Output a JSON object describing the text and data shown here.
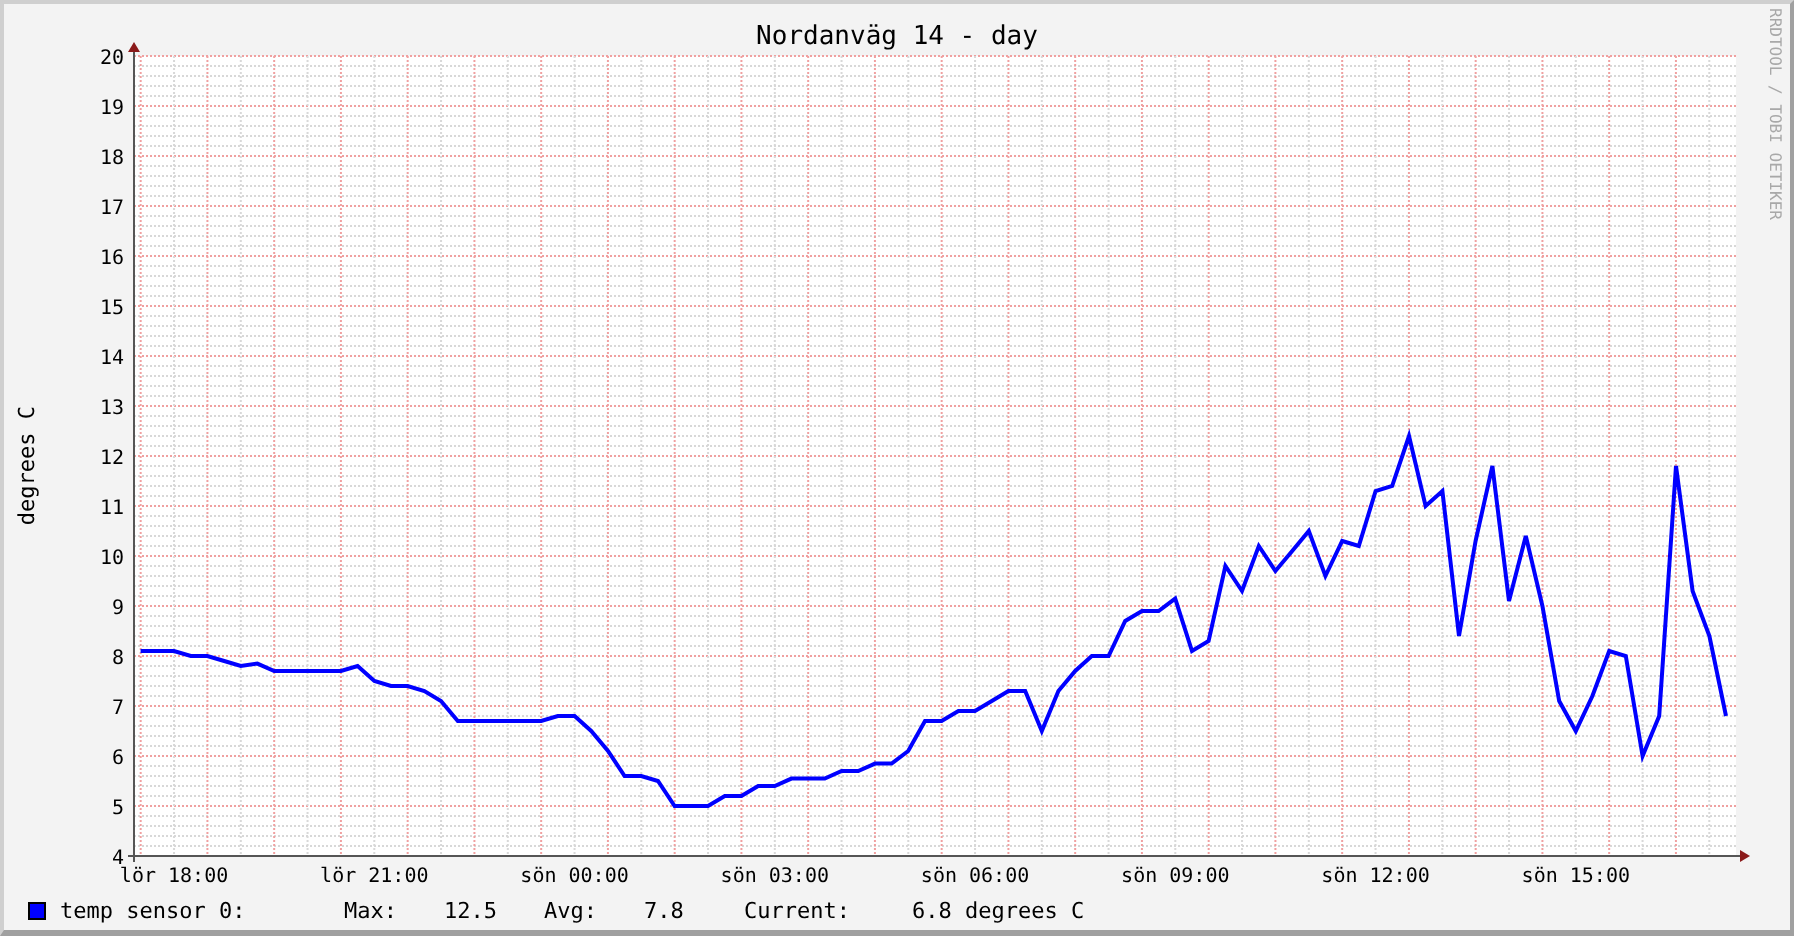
{
  "chart": {
    "chart_data": {
      "type": "line",
      "title": "Nordanväg 14 - day",
      "ylabel": "degrees C",
      "ylim": [
        4,
        20
      ],
      "grid": true,
      "yticks": [
        4,
        5,
        6,
        7,
        8,
        9,
        10,
        11,
        12,
        13,
        14,
        15,
        16,
        17,
        18,
        19,
        20
      ],
      "categories": [
        null,
        null,
        "lör 18:00",
        null,
        null,
        null,
        null,
        null,
        null,
        null,
        null,
        null,
        null,
        null,
        "lör 21:00",
        null,
        null,
        null,
        null,
        null,
        null,
        null,
        null,
        null,
        null,
        null,
        "sön 00:00",
        null,
        null,
        null,
        null,
        null,
        null,
        null,
        null,
        null,
        null,
        null,
        "sön 03:00",
        null,
        null,
        null,
        null,
        null,
        null,
        null,
        null,
        null,
        null,
        null,
        "sön 06:00",
        null,
        null,
        null,
        null,
        null,
        null,
        null,
        null,
        null,
        null,
        null,
        "sön 09:00",
        null,
        null,
        null,
        null,
        null,
        null,
        null,
        null,
        null,
        null,
        null,
        "sön 12:00",
        null,
        null,
        null,
        null,
        null,
        null,
        null,
        null,
        null,
        null,
        null,
        "sön 15:00",
        null,
        null,
        null,
        null,
        null,
        null,
        null,
        null,
        null
      ],
      "series": [
        {
          "name": "temp sensor 0:",
          "color": "#0000ff",
          "values": [
            8.1,
            8.1,
            8.1,
            8.0,
            8.0,
            7.9,
            7.8,
            7.85,
            7.7,
            7.7,
            7.7,
            7.7,
            7.7,
            7.8,
            7.5,
            7.4,
            7.4,
            7.3,
            7.1,
            6.7,
            6.7,
            6.7,
            6.7,
            6.7,
            6.7,
            6.8,
            6.8,
            6.5,
            6.1,
            5.6,
            5.6,
            5.5,
            5.0,
            5.0,
            5.0,
            5.2,
            5.2,
            5.4,
            5.4,
            5.55,
            5.55,
            5.55,
            5.7,
            5.7,
            5.85,
            5.85,
            6.1,
            6.7,
            6.7,
            6.9,
            6.9,
            7.1,
            7.3,
            7.3,
            6.5,
            7.3,
            7.7,
            8.0,
            8.0,
            8.7,
            8.9,
            8.9,
            9.15,
            8.1,
            8.3,
            9.8,
            9.3,
            10.2,
            9.7,
            10.1,
            10.5,
            9.6,
            10.3,
            10.2,
            11.3,
            11.4,
            12.4,
            11.0,
            11.3,
            8.4,
            10.3,
            11.8,
            9.1,
            10.4,
            9.0,
            7.1,
            6.5,
            7.2,
            8.1,
            8.0,
            6.0,
            6.8,
            11.8,
            9.3,
            8.4,
            6.8
          ]
        }
      ]
    },
    "credit": "RRDTOOL / TOBI OETIKER",
    "legend": {
      "max_label": "Max:",
      "max": "12.5",
      "avg_label": "Avg:",
      "avg": "7.8",
      "current_label": "Current:",
      "current": "6.8 degrees C"
    }
  }
}
